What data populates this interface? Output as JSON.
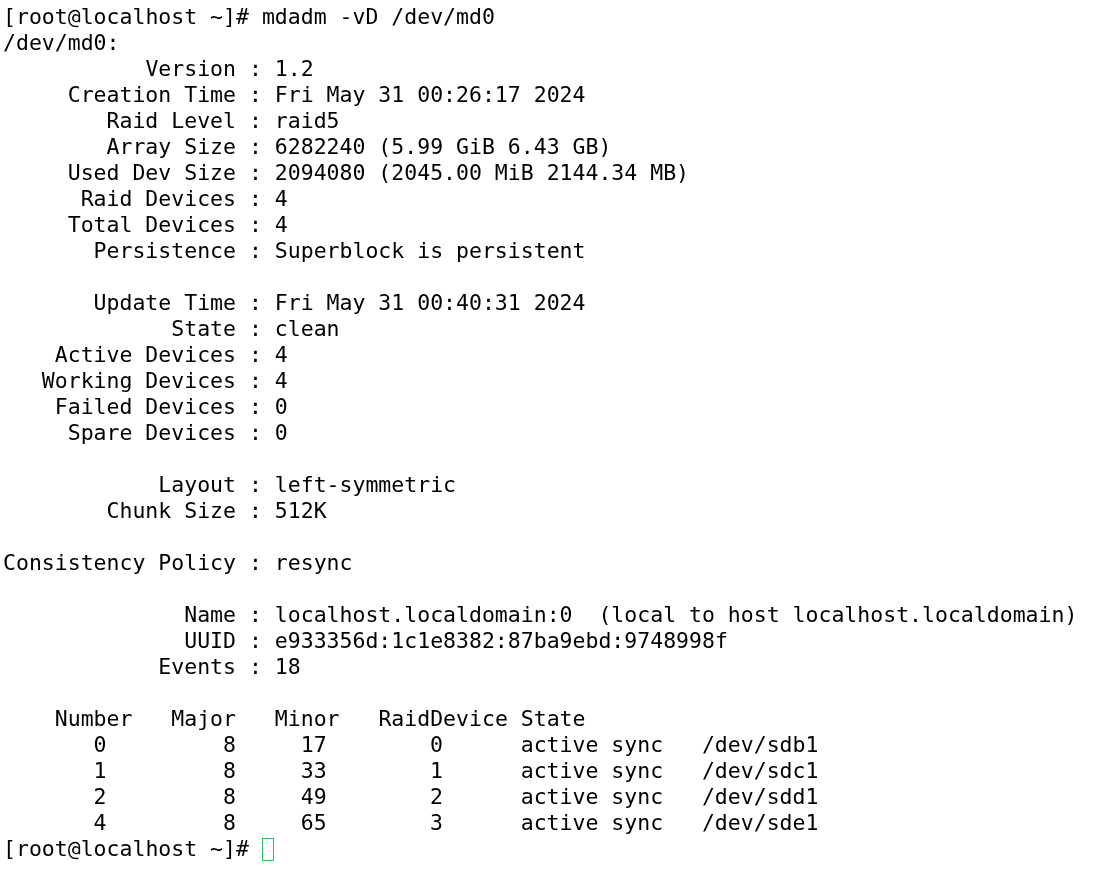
{
  "command_line": "[root@localhost ~]# mdadm -vD /dev/md0",
  "device": "/dev/md0:",
  "separator": ":",
  "sections": [
    [
      {
        "label": "Version",
        "value": "1.2"
      },
      {
        "label": "Creation Time",
        "value": "Fri May 31 00:26:17 2024"
      },
      {
        "label": "Raid Level",
        "value": "raid5"
      },
      {
        "label": "Array Size",
        "value": "6282240 (5.99 GiB 6.43 GB)"
      },
      {
        "label": "Used Dev Size",
        "value": "2094080 (2045.00 MiB 2144.34 MB)"
      },
      {
        "label": "Raid Devices",
        "value": "4"
      },
      {
        "label": "Total Devices",
        "value": "4"
      },
      {
        "label": "Persistence",
        "value": "Superblock is persistent"
      }
    ],
    [
      {
        "label": "Update Time",
        "value": "Fri May 31 00:40:31 2024"
      },
      {
        "label": "State",
        "value": "clean"
      },
      {
        "label": "Active Devices",
        "value": "4"
      },
      {
        "label": "Working Devices",
        "value": "4"
      },
      {
        "label": "Failed Devices",
        "value": "0"
      },
      {
        "label": "Spare Devices",
        "value": "0"
      }
    ],
    [
      {
        "label": "Layout",
        "value": "left-symmetric"
      },
      {
        "label": "Chunk Size",
        "value": "512K"
      }
    ],
    [
      {
        "label": "Consistency Policy",
        "value": "resync"
      }
    ],
    [
      {
        "label": "Name",
        "value": "localhost.localdomain:0  (local to host localhost.localdomain)"
      },
      {
        "label": "UUID",
        "value": "e933356d:1c1e8382:87ba9ebd:9748998f"
      },
      {
        "label": "Events",
        "value": "18"
      }
    ]
  ],
  "table": {
    "columns": [
      "Number",
      "Major",
      "Minor",
      "RaidDevice",
      "State"
    ],
    "rows": [
      [
        "0",
        "8",
        "17",
        "0",
        "active sync",
        "/dev/sdb1"
      ],
      [
        "1",
        "8",
        "33",
        "1",
        "active sync",
        "/dev/sdc1"
      ],
      [
        "2",
        "8",
        "49",
        "2",
        "active sync",
        "/dev/sdd1"
      ],
      [
        "4",
        "8",
        "65",
        "3",
        "active sync",
        "/dev/sde1"
      ]
    ]
  },
  "prompt": "[root@localhost ~]#"
}
